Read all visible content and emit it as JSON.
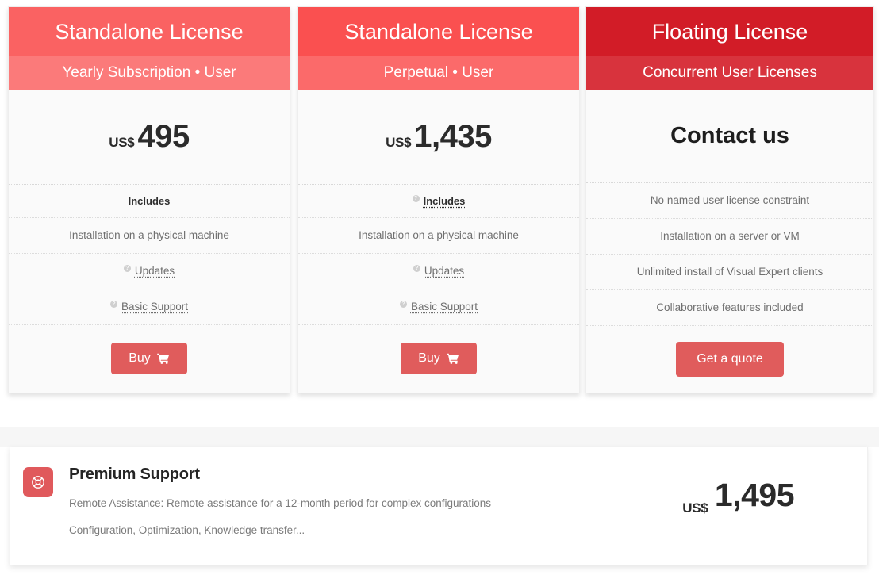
{
  "colors": {
    "card1_header": "#fa6262",
    "card1_subheader": "#fb7a7a",
    "card2_header": "#fa5050",
    "card2_subheader": "#fb6a6a",
    "card3_header": "#d21c27",
    "card3_subheader": "#d8333d",
    "button": "#e05c5c",
    "premium_icon_bg": "#e0595c",
    "card_bg": "#fafafa",
    "page_bg": "#ffffff"
  },
  "cards": [
    {
      "title": "Standalone License",
      "subtitle": "Yearly Subscription • User",
      "currency": "US$",
      "price": "495",
      "includes_label": "Includes",
      "includes_has_help_icon": false,
      "features": [
        {
          "text": "Installation on a physical machine",
          "help_icon": false,
          "link": false
        },
        {
          "text": "Updates",
          "help_icon": true,
          "link": true
        },
        {
          "text": "Basic Support",
          "help_icon": true,
          "link": true
        }
      ],
      "cta_label": "Buy",
      "cta_icon": "cart-icon"
    },
    {
      "title": "Standalone License",
      "subtitle": "Perpetual • User",
      "currency": "US$",
      "price": "1,435",
      "includes_label": "Includes",
      "includes_has_help_icon": true,
      "features": [
        {
          "text": "Installation on a physical machine",
          "help_icon": false,
          "link": false
        },
        {
          "text": "Updates",
          "help_icon": true,
          "link": true
        },
        {
          "text": "Basic Support",
          "help_icon": true,
          "link": true
        }
      ],
      "cta_label": "Buy",
      "cta_icon": "cart-icon"
    },
    {
      "title": "Floating License",
      "subtitle": "Concurrent User Licenses",
      "currency": "",
      "price": "Contact us",
      "includes_label": "",
      "includes_has_help_icon": false,
      "features": [
        {
          "text": "No named user license constraint",
          "help_icon": false,
          "link": false
        },
        {
          "text": "Installation on a server or VM",
          "help_icon": false,
          "link": false
        },
        {
          "text": "Unlimited install of Visual Expert clients",
          "help_icon": false,
          "link": false
        },
        {
          "text": "Collaborative features included",
          "help_icon": false,
          "link": false
        }
      ],
      "cta_label": "Get a quote",
      "cta_icon": ""
    }
  ],
  "premium": {
    "icon": "lifebuoy-icon",
    "title": "Premium Support",
    "line1": "Remote Assistance: Remote assistance for a 12-month period for complex configurations",
    "line2": "Configuration, Optimization, Knowledge transfer...",
    "currency": "US$",
    "price": "1,495"
  }
}
